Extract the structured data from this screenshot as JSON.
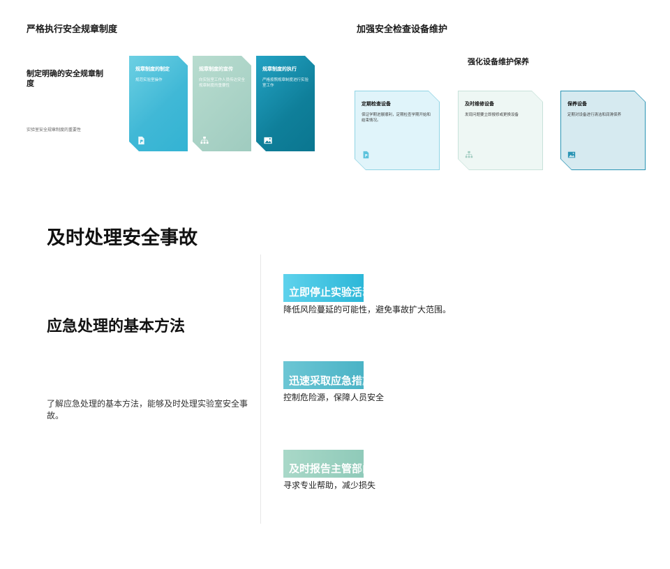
{
  "slide1": {
    "title": "严格执行安全规章制度",
    "subtitle": "制定明确的安全规章制度",
    "note": "实验室安全规章制度的重要性",
    "cards": [
      {
        "title": "规章制度的制定",
        "desc": "规范实验室操作",
        "icon": "document-icon"
      },
      {
        "title": "规章制度的宣传",
        "desc": "向实验室工作人员传达安全规章制度的重要性",
        "icon": "org-chart-icon"
      },
      {
        "title": "规章制度的执行",
        "desc": "严格按照规章制度进行实验室工作",
        "icon": "image-icon"
      }
    ]
  },
  "slide2": {
    "title": "加强安全检查设备维护",
    "subtitle": "强化设备维护保养",
    "cards": [
      {
        "title": "定期检查设备",
        "desc": "保证学期进展顺利，定期检查学期开始和结束情况。",
        "icon": "document-icon"
      },
      {
        "title": "及时维修设备",
        "desc": "发现问题要立即报修或更换设备",
        "icon": "org-chart-icon"
      },
      {
        "title": "保养设备",
        "desc": "定期对设备进行清洁和润滑保养",
        "icon": "image-icon"
      }
    ]
  },
  "slide3": {
    "title": "及时处理安全事故",
    "subtitle": "应急处理的基本方法",
    "desc": "了解应急处理的基本方法，能够及时处理实验室安全事故。",
    "steps": [
      {
        "label": "立即停止实验活动",
        "desc": "降低风险蔓延的可能性，避免事故扩大范围。"
      },
      {
        "label": "迅速采取应急措施",
        "desc": "控制危险源，保障人员安全"
      },
      {
        "label": "及时报告主管部门",
        "desc": "寻求专业帮助，减少损失"
      }
    ]
  },
  "colors": {
    "accent_cyan": "#33b3d3",
    "accent_mint": "#9fcbbf",
    "accent_teal": "#0f7f9a"
  }
}
